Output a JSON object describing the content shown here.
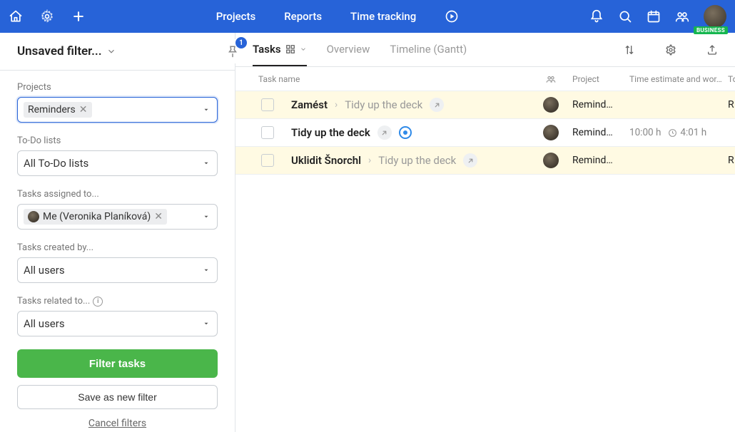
{
  "topnav": {
    "projects": "Projects",
    "reports": "Reports",
    "time_tracking": "Time tracking",
    "business_badge": "BUSINESS"
  },
  "sidebar": {
    "title": "Unsaved filter...",
    "pin_count": "1",
    "fields": {
      "projects_label": "Projects",
      "projects_chip": "Reminders",
      "todo_label": "To-Do lists",
      "todo_value": "All To-Do lists",
      "assigned_label": "Tasks assigned to...",
      "assigned_chip": "Me (Veronika Planíková)",
      "created_label": "Tasks created by...",
      "created_value": "All users",
      "related_label": "Tasks related to...",
      "related_value": "All users"
    },
    "buttons": {
      "filter": "Filter tasks",
      "save": "Save as new filter",
      "cancel": "Cancel filters"
    }
  },
  "tabs": {
    "tasks": "Tasks",
    "overview": "Overview",
    "timeline": "Timeline (Gantt)"
  },
  "columns": {
    "task_name": "Task name",
    "project": "Project",
    "estimate": "Time estimate and wor…",
    "tail": "To"
  },
  "rows": [
    {
      "hl": true,
      "name": "Zamést",
      "crumb": "Tidy up the deck",
      "project": "Remind…",
      "estimate": "",
      "worked": "",
      "tail": "R",
      "show_inbox": false
    },
    {
      "hl": false,
      "name": "Tidy up the deck",
      "crumb": "",
      "project": "Remind…",
      "estimate": "10:00 h",
      "worked": "4:01 h",
      "tail": "",
      "show_inbox": true
    },
    {
      "hl": true,
      "name": "Uklidit Šnorchl",
      "crumb": "Tidy up the deck",
      "project": "Remind…",
      "estimate": "",
      "worked": "",
      "tail": "R",
      "show_inbox": false
    }
  ]
}
